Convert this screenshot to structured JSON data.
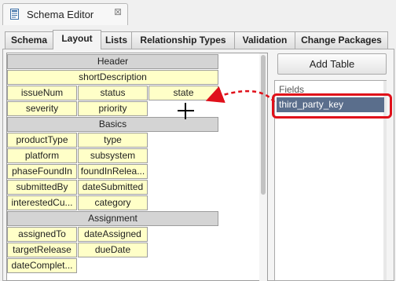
{
  "window": {
    "title": "Schema Editor",
    "close_glyph": "⊠"
  },
  "tabs": [
    {
      "label": "Schema",
      "active": false
    },
    {
      "label": "Layout",
      "active": true
    },
    {
      "label": "Lists",
      "active": false
    },
    {
      "label": "Relationship Types",
      "active": false
    },
    {
      "label": "Validation",
      "active": false
    },
    {
      "label": "Change Packages",
      "active": false
    }
  ],
  "layout": {
    "header": {
      "title": "Header",
      "short_description": "shortDescription",
      "issue_num": "issueNum",
      "status": "status",
      "state": "state",
      "severity": "severity",
      "priority": "priority"
    },
    "basics": {
      "title": "Basics",
      "product_type": "productType",
      "type": "type",
      "platform": "platform",
      "subsystem": "subsystem",
      "phase_found_in": "phaseFoundIn",
      "found_in_release": "foundInRelea...",
      "submitted_by": "submittedBy",
      "date_submitted": "dateSubmitted",
      "interested_customers": "interestedCu...",
      "category": "category"
    },
    "assignment": {
      "title": "Assignment",
      "assigned_to": "assignedTo",
      "date_assigned": "dateAssigned",
      "target_release": "targetRelease",
      "due_date": "dueDate",
      "date_completed": "dateComplet..."
    }
  },
  "right_panel": {
    "add_table_label": "Add Table",
    "fields_label": "Fields",
    "fields": [
      "third_party_key"
    ]
  },
  "colors": {
    "field_bg": "#ffffc8",
    "header_bg": "#d4d4d4",
    "selection_bg": "#5a6e8c",
    "highlight_red": "#e0101a"
  },
  "icons": {
    "window_icon": "schema-doc-icon",
    "close": "close-icon",
    "drop_cursor": "crosshair-cursor-icon",
    "drag_arrow": "drag-arrow-icon"
  }
}
